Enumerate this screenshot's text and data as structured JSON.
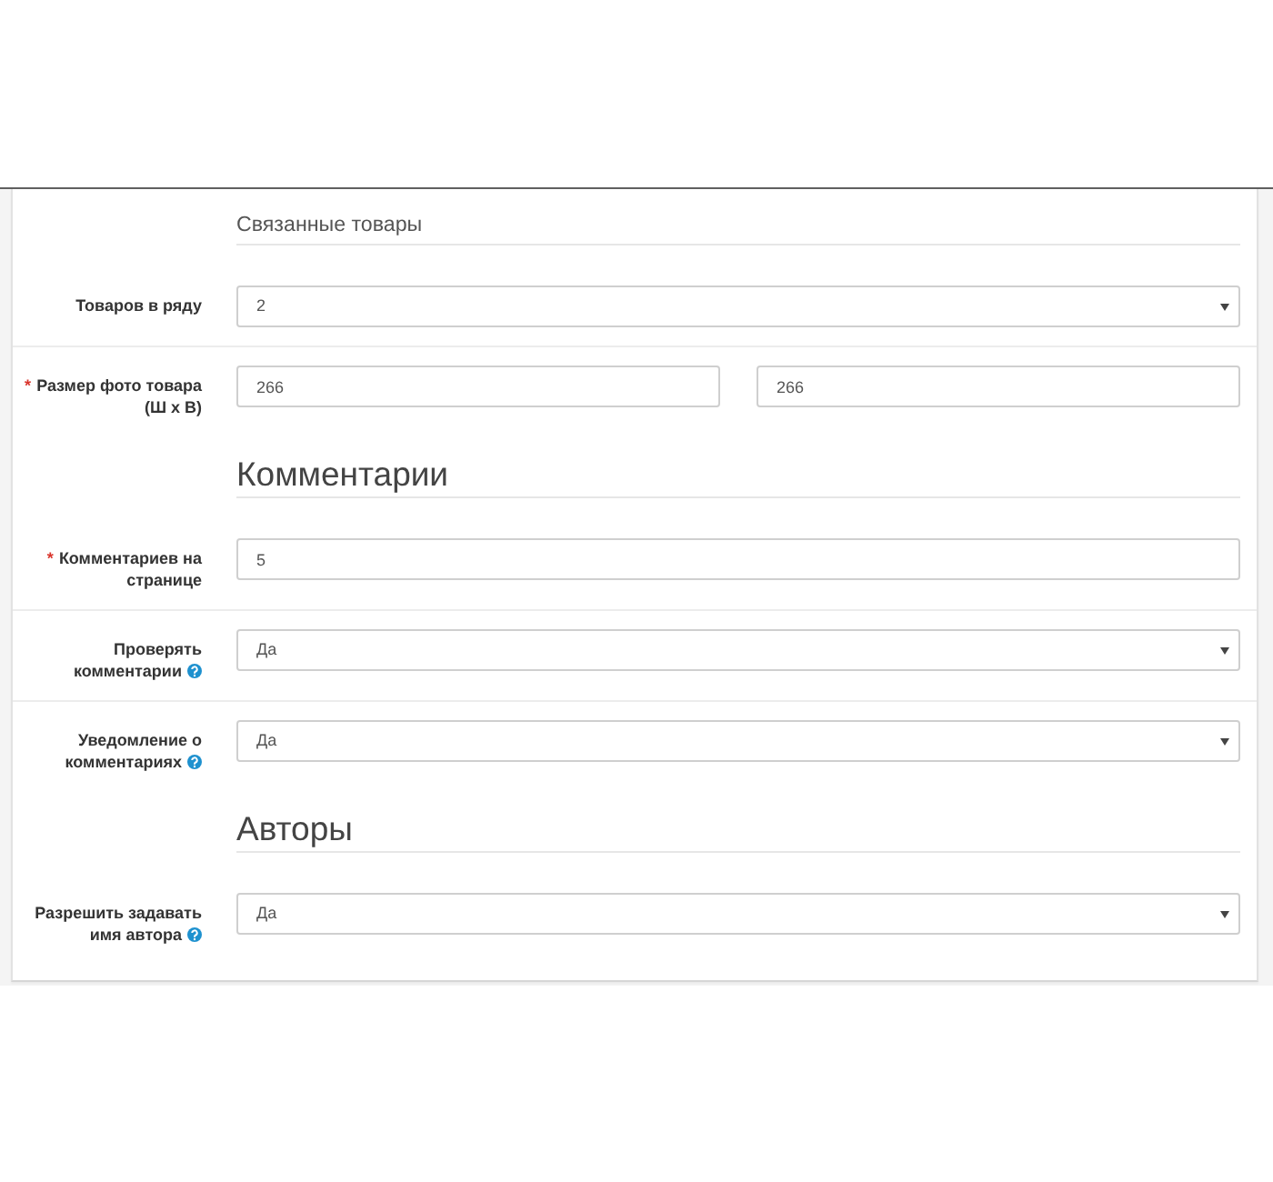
{
  "form": [
    {
      "kind": "subheading",
      "text": "Связанные товары"
    },
    {
      "kind": "dropdown",
      "label": "Товаров в ряду",
      "help": false,
      "value": "2"
    },
    {
      "kind": "pair",
      "label": "Размер фото товара (Ш x В)",
      "required_mark": "*",
      "help": false,
      "values": [
        "266",
        "266"
      ]
    },
    {
      "kind": "heading",
      "text": "Комментарии"
    },
    {
      "kind": "text",
      "label": "Комментариев на странице",
      "required_mark": "*",
      "help": false,
      "value": "5"
    },
    {
      "kind": "dropdown",
      "label": "Проверять комментарии",
      "help": true,
      "value": "Да"
    },
    {
      "kind": "dropdown",
      "label": "Уведомление о комментариях",
      "help": true,
      "value": "Да"
    },
    {
      "kind": "heading",
      "text": "Авторы"
    },
    {
      "kind": "dropdown",
      "label": "Разрешить задавать имя автора",
      "help": true,
      "value": "Да"
    }
  ]
}
